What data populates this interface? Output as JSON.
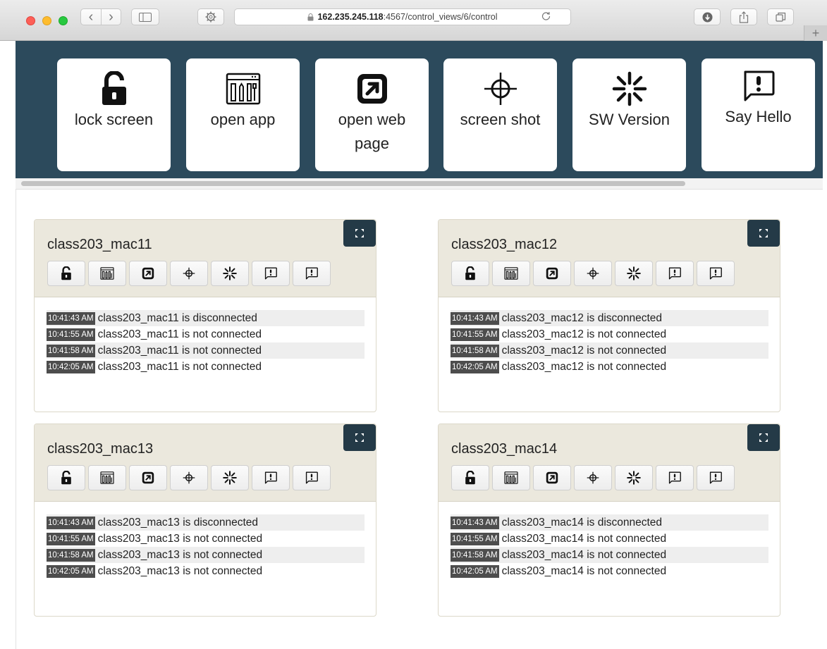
{
  "browser": {
    "url_host": "162.235.245.118",
    "url_path": ":4567/control_views/6/control",
    "back_glyph": "‹",
    "forward_glyph": "›",
    "newtab_glyph": "+"
  },
  "actions": [
    {
      "id": "lock-screen",
      "label": "lock screen",
      "icon": "lock-icon"
    },
    {
      "id": "open-app",
      "label": "open app",
      "icon": "app-window-icon"
    },
    {
      "id": "open-web-page",
      "label": "open web page",
      "icon": "external-link-icon"
    },
    {
      "id": "screen-shot",
      "label": "screen shot",
      "icon": "crosshair-icon"
    },
    {
      "id": "sw-version",
      "label": "SW Version",
      "icon": "spinner-icon"
    },
    {
      "id": "say-hello",
      "label": "Say Hello",
      "icon": "message-alert-icon"
    }
  ],
  "panels": [
    {
      "name": "class203_mac11",
      "log": [
        {
          "time": "10:41:43 AM",
          "msg": "class203_mac11 is disconnected"
        },
        {
          "time": "10:41:55 AM",
          "msg": "class203_mac11 is not connected"
        },
        {
          "time": "10:41:58 AM",
          "msg": "class203_mac11 is not connected"
        },
        {
          "time": "10:42:05 AM",
          "msg": "class203_mac11 is not connected"
        }
      ]
    },
    {
      "name": "class203_mac12",
      "log": [
        {
          "time": "10:41:43 AM",
          "msg": "class203_mac12 is disconnected"
        },
        {
          "time": "10:41:55 AM",
          "msg": "class203_mac12 is not connected"
        },
        {
          "time": "10:41:58 AM",
          "msg": "class203_mac12 is not connected"
        },
        {
          "time": "10:42:05 AM",
          "msg": "class203_mac12 is not connected"
        }
      ]
    },
    {
      "name": "class203_mac13",
      "log": [
        {
          "time": "10:41:43 AM",
          "msg": "class203_mac13 is disconnected"
        },
        {
          "time": "10:41:55 AM",
          "msg": "class203_mac13 is not connected"
        },
        {
          "time": "10:41:58 AM",
          "msg": "class203_mac13 is not connected"
        },
        {
          "time": "10:42:05 AM",
          "msg": "class203_mac13 is not connected"
        }
      ]
    },
    {
      "name": "class203_mac14",
      "log": [
        {
          "time": "10:41:43 AM",
          "msg": "class203_mac14 is disconnected"
        },
        {
          "time": "10:41:55 AM",
          "msg": "class203_mac14 is not connected"
        },
        {
          "time": "10:41:58 AM",
          "msg": "class203_mac14 is not connected"
        },
        {
          "time": "10:42:05 AM",
          "msg": "class203_mac14 is not connected"
        }
      ]
    }
  ],
  "panel_buttons": [
    "lock-icon",
    "app-window-icon",
    "external-link-icon",
    "crosshair-icon",
    "spinner-icon",
    "message-alert-icon",
    "message-alert-icon"
  ],
  "colors": {
    "header_bg": "#2c4a5c",
    "panel_head_bg": "#ebe8dd",
    "expand_btn": "#243a47",
    "stamp_bg": "#4d4d4d"
  }
}
